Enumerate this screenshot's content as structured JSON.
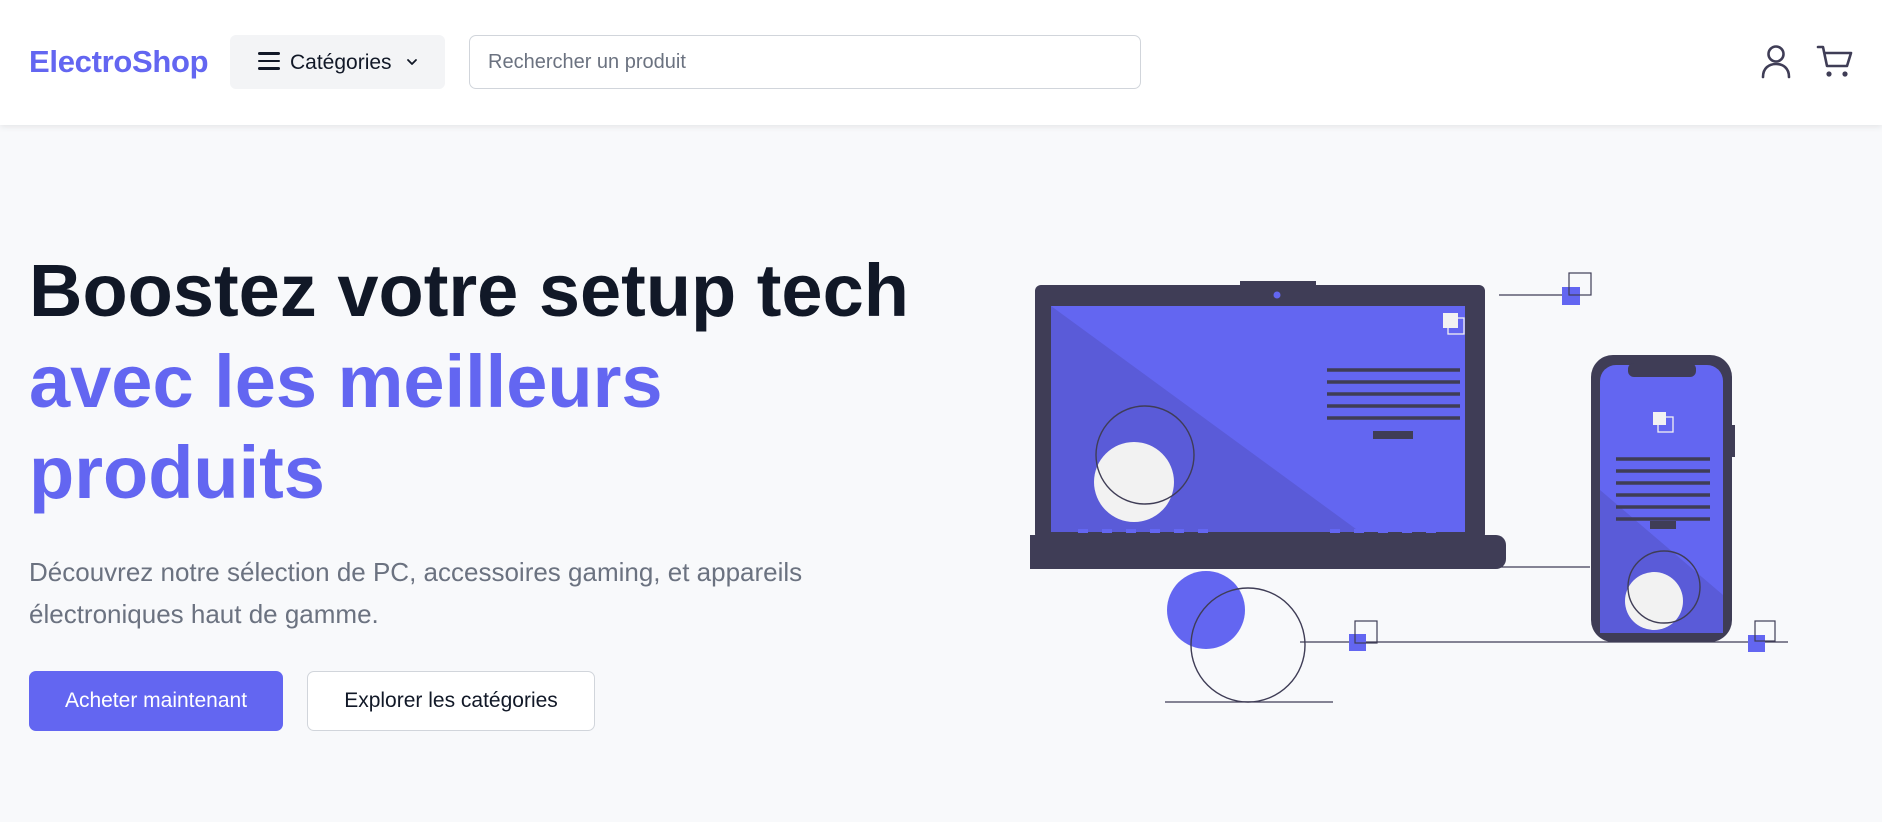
{
  "header": {
    "logo": "ElectroShop",
    "categories_label": "Catégories",
    "search_placeholder": "Rechercher un produit",
    "icons": [
      "menu-icon",
      "chevron-down-icon",
      "user-icon",
      "cart-icon"
    ]
  },
  "hero": {
    "title_line1": "Boostez votre setup tech",
    "title_line2": "avec les meilleurs",
    "title_line3": "produits",
    "description": "Découvrez notre sélection de PC, accessoires gaming, et appareils électroniques haut de gamme.",
    "primary_button": "Acheter maintenant",
    "secondary_button": "Explorer les catégories"
  },
  "colors": {
    "brand": "#6366f1",
    "dark": "#3f3d56",
    "text": "#111827",
    "muted": "#6b7280",
    "background": "#f8f9fb"
  }
}
